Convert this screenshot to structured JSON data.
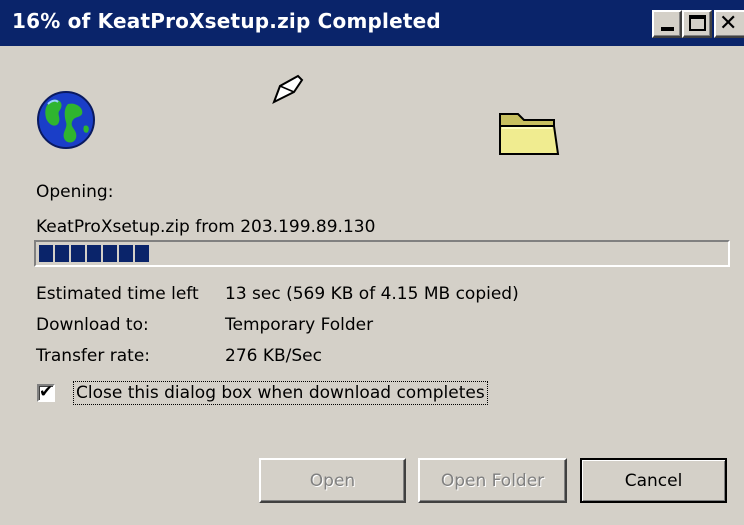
{
  "window": {
    "title": "16% of KeatProXsetup.zip Completed"
  },
  "caption_buttons": {
    "minimize_icon": "minimize-icon",
    "maximize_icon": "maximize-icon",
    "close_glyph": "✕"
  },
  "animation": {
    "source_icon": "globe-icon",
    "transfer_icon": "flying-paper-icon",
    "destination_icon": "folder-icon"
  },
  "status": {
    "opening_label": "Opening:",
    "source_line": "KeatProXsetup.zip from 203.199.89.130",
    "progress_fraction": 0.16
  },
  "details": {
    "time_left_label": "Estimated time left",
    "time_left_value": "13 sec (569 KB of 4.15 MB copied)",
    "download_to_label": "Download to:",
    "download_to_value": "Temporary Folder",
    "transfer_rate_label": "Transfer rate:",
    "transfer_rate_value": "276 KB/Sec"
  },
  "close_option": {
    "checked": true,
    "check_glyph": "✔",
    "label": "Close this dialog box when download completes"
  },
  "buttons": {
    "open": "Open",
    "open_folder": "Open Folder",
    "cancel": "Cancel"
  },
  "colors": {
    "titlebar": "#0a246a",
    "dialog_bg": "#d4d0c8",
    "progress_fill": "#0a246a"
  }
}
